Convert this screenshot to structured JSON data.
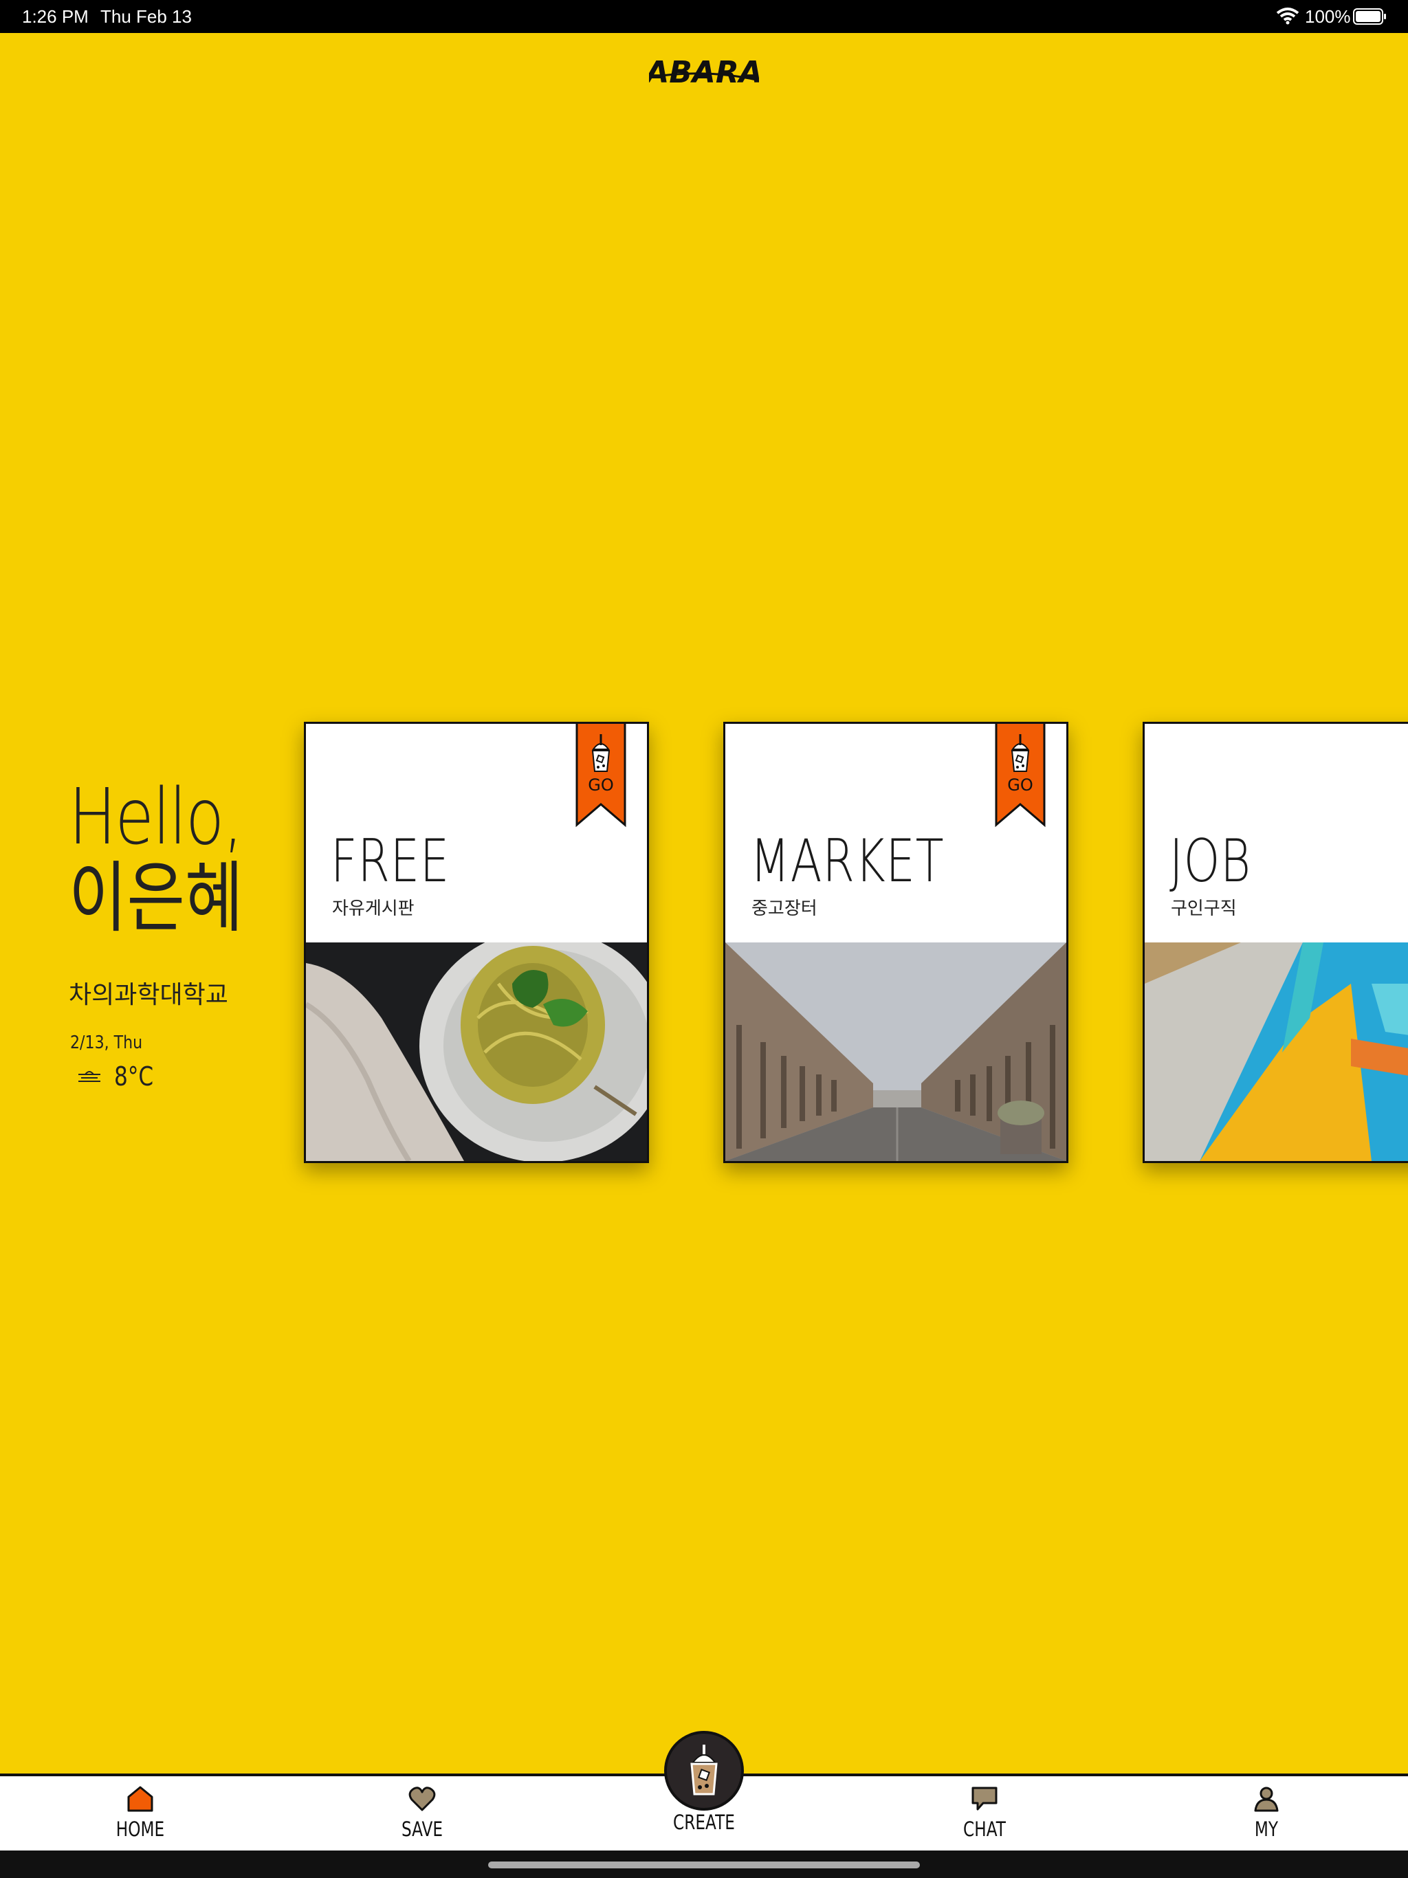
{
  "status_bar": {
    "time": "1:26 PM",
    "date": "Thu Feb 13",
    "battery": "100%"
  },
  "app": {
    "logo_text": "ABARA"
  },
  "greeting": {
    "hello": "Hello,",
    "name": "이은혜",
    "school": "차의과학대학교",
    "date": "2/13, Thu",
    "temperature": "8°C",
    "weather_icon": "fog-icon"
  },
  "cards": [
    {
      "title": "FREE",
      "subtitle": "자유게시판",
      "ribbon_label": "GO",
      "photo": "pasta-plate"
    },
    {
      "title": "MARKET",
      "subtitle": "중고장터",
      "ribbon_label": "GO",
      "photo": "city-street"
    },
    {
      "title": "JOB",
      "subtitle": "구인구직",
      "photo": "colorful-architecture"
    }
  ],
  "nav": {
    "home": "HOME",
    "save": "SAVE",
    "create": "CREATE",
    "chat": "CHAT",
    "my": "MY"
  },
  "colors": {
    "background": "#F6CF00",
    "accent": "#F25C05",
    "dark": "#111111"
  }
}
